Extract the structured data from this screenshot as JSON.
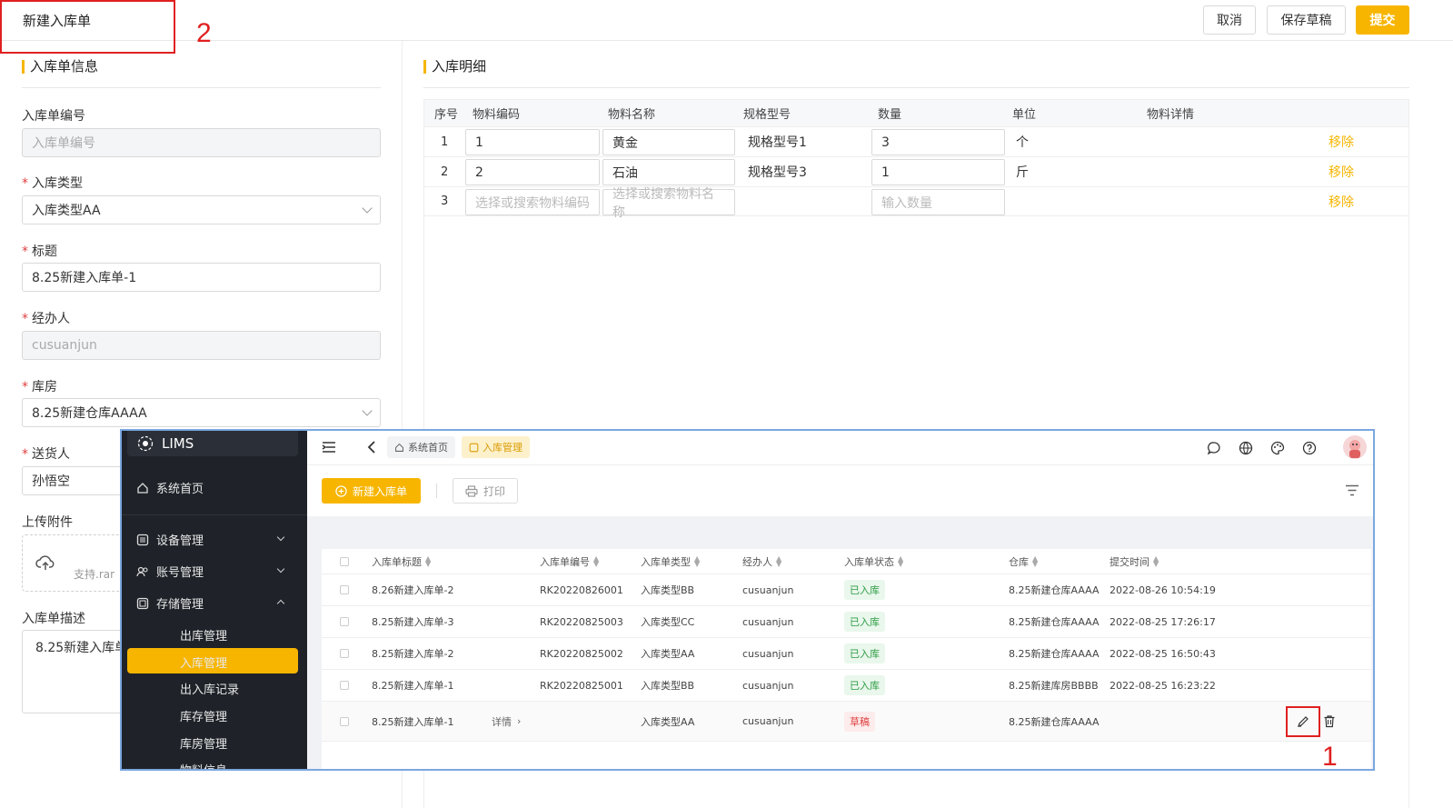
{
  "page": {
    "title": "新建入库单",
    "actions": {
      "cancel": "取消",
      "save_draft": "保存草稿",
      "submit": "提交"
    }
  },
  "annotations": {
    "box_title": "2",
    "box_edit": "1"
  },
  "form": {
    "section_title": "入库单信息",
    "fields": {
      "order_no": {
        "label": "入库单编号",
        "placeholder": "入库单编号"
      },
      "type": {
        "label": "入库类型",
        "value": "入库类型AA"
      },
      "title": {
        "label": "标题",
        "value": "8.25新建入库单-1"
      },
      "handler": {
        "label": "经办人",
        "value": "cusuanjun"
      },
      "warehouse": {
        "label": "库房",
        "value": "8.25新建仓库AAAA"
      },
      "deliverer": {
        "label": "送货人",
        "value": "孙悟空"
      },
      "attachment": {
        "label": "上传附件",
        "hint": "支持.rar"
      },
      "description": {
        "label": "入库单描述",
        "value": "8.25新建入库单"
      }
    },
    "required_mark": "*"
  },
  "detail": {
    "section_title": "入库明细",
    "columns": [
      "序号",
      "物料编码",
      "物料名称",
      "规格型号",
      "数量",
      "单位",
      "物料详情",
      ""
    ],
    "rows": [
      {
        "no": "1",
        "code": "1",
        "name": "黄金",
        "spec": "规格型号1",
        "qty": "3",
        "unit": "个",
        "action": "移除"
      },
      {
        "no": "2",
        "code": "2",
        "name": "石油",
        "spec": "规格型号3",
        "qty": "1",
        "unit": "斤",
        "action": "移除"
      },
      {
        "no": "3",
        "code_placeholder": "选择或搜索物料编码",
        "name_placeholder": "选择或搜索物料名称",
        "spec": "",
        "qty_placeholder": "输入数量",
        "unit": "",
        "action": "移除"
      }
    ]
  },
  "app": {
    "logo": "LIMS",
    "nav": {
      "home": "系统首页",
      "device": "设备管理",
      "account": "账号管理",
      "storage": "存储管理",
      "storage_children": [
        "出库管理",
        "入库管理",
        "出入库记录",
        "库存管理",
        "库房管理",
        "物料信息"
      ]
    },
    "tabs": [
      "系统首页",
      "入库管理"
    ],
    "toolbar": {
      "new": "新建入库单",
      "print": "打印"
    },
    "grid": {
      "columns": [
        "入库单标题",
        "入库单编号",
        "入库单类型",
        "经办人",
        "入库单状态",
        "仓库",
        "提交时间"
      ],
      "rows": [
        {
          "title": "8.26新建入库单-2",
          "no": "RK20220826001",
          "type": "入库类型BB",
          "handler": "cusuanjun",
          "status": "已入库",
          "warehouse": "8.25新建仓库AAAA",
          "time": "2022-08-26 10:54:19"
        },
        {
          "title": "8.25新建入库单-3",
          "no": "RK20220825003",
          "type": "入库类型CC",
          "handler": "cusuanjun",
          "status": "已入库",
          "warehouse": "8.25新建仓库AAAA",
          "time": "2022-08-25 17:26:17"
        },
        {
          "title": "8.25新建入库单-2",
          "no": "RK20220825002",
          "type": "入库类型AA",
          "handler": "cusuanjun",
          "status": "已入库",
          "warehouse": "8.25新建仓库AAAA",
          "time": "2022-08-25 16:50:43"
        },
        {
          "title": "8.25新建入库单-1",
          "no": "RK20220825001",
          "type": "入库类型BB",
          "handler": "cusuanjun",
          "status": "已入库",
          "warehouse": "8.25新建库房BBBB",
          "time": "2022-08-25 16:23:22"
        },
        {
          "title": "8.25新建入库单-1",
          "detail": "详情",
          "no": "",
          "type": "入库类型AA",
          "handler": "cusuanjun",
          "status": "草稿",
          "warehouse": "8.25新建仓库AAAA",
          "time": ""
        }
      ]
    }
  },
  "colors": {
    "accent": "#f7b500",
    "annotation": "#e02020",
    "sidebar": "#1f2329"
  }
}
